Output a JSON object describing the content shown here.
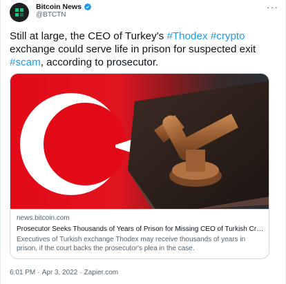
{
  "account": {
    "name": "Bitcoin News",
    "handle": "@BTCTN",
    "verified_icon": "verified-badge-icon",
    "more_icon": "more-options-icon"
  },
  "tweet": {
    "part1": "Still at large, the CEO of Turkey's ",
    "tag1": "#Thodex",
    "space1": " ",
    "tag2": "#crypto",
    "part2": " exchange could serve life in prison for suspected exit ",
    "tag3": "#scam",
    "part3": ", according to prosecutor."
  },
  "card": {
    "image_alt": "Turkish flag and judge's gavel on book",
    "domain": "news.bitcoin.com",
    "title": "Prosecutor Seeks Thousands of Years of Prison for Missing CEO of Turkish Cry...",
    "description": "Executives of Turkish exchange Thodex may receive thousands of years in prison, if the court backs the prosecutor's plea in the case."
  },
  "footer": {
    "time": "6:01 PM",
    "separator1": "·",
    "date": "Apr 3, 2022",
    "separator2": "·",
    "source": "Zapier.com"
  },
  "colors": {
    "link": "#1d9bf0",
    "text": "#0f1419",
    "muted": "#536471",
    "flag_red": "#e30a17"
  }
}
